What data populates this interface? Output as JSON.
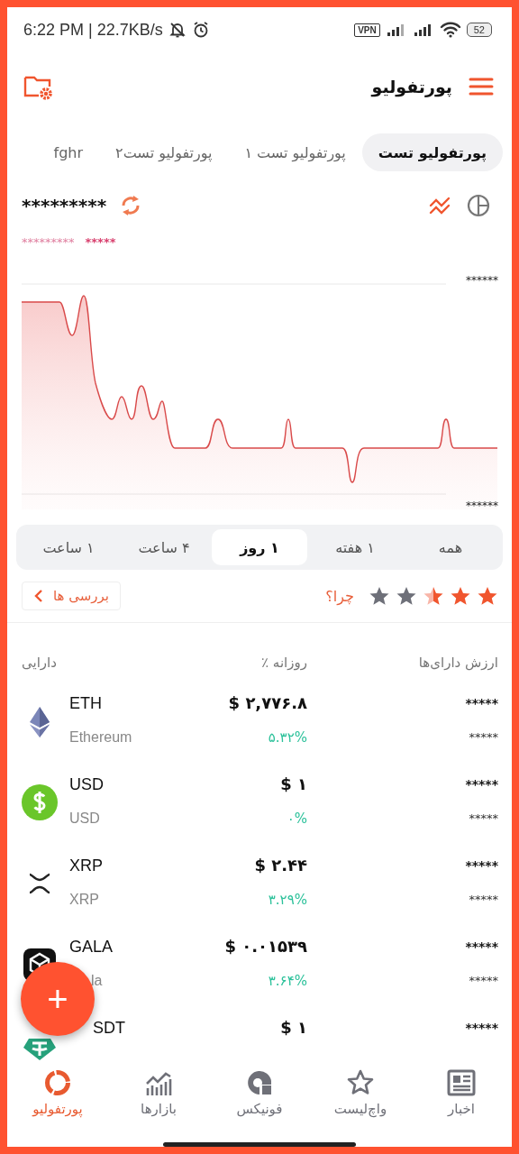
{
  "status_bar": {
    "time": "6:22 PM | 22.7KB/s",
    "vpn": "VPN",
    "battery": "52"
  },
  "header": {
    "title": "پورتفولیو"
  },
  "portfolio_tabs": [
    {
      "label": "پورتفولیو تست",
      "selected": true
    },
    {
      "label": "پورتفولیو تست ۱",
      "selected": false
    },
    {
      "label": "پورتفولیو تست۲",
      "selected": false
    },
    {
      "label": "fghr",
      "selected": false
    }
  ],
  "summary": {
    "total": "*********",
    "change_amount": "*********",
    "change_percent": "*****"
  },
  "chart": {
    "top_label": "******",
    "bottom_label": "******"
  },
  "ranges": [
    {
      "label": "همه",
      "selected": false
    },
    {
      "label": "۱ هفته",
      "selected": false
    },
    {
      "label": "۱ روز",
      "selected": true
    },
    {
      "label": "۴ ساعت",
      "selected": false
    },
    {
      "label": "۱ ساعت",
      "selected": false
    }
  ],
  "rating": {
    "stars": 2.5,
    "why_link": "چرا؟",
    "reviews_button": "بررسی ها"
  },
  "table": {
    "columns": [
      "ارزش دارای‌ها",
      "روزانه ٪",
      "دارایی"
    ],
    "rows": [
      {
        "kind": "eth",
        "symbol": "ETH",
        "name": "Ethereum",
        "price": "$ ۲,۷۷۶.۸",
        "change": "۵.۳۲%",
        "value": "*****",
        "amount": "*****"
      },
      {
        "kind": "usd",
        "symbol": "USD",
        "name": "USD",
        "price": "$ ۱",
        "change": "۰%",
        "value": "*****",
        "amount": "*****"
      },
      {
        "kind": "xrp",
        "symbol": "XRP",
        "name": "XRP",
        "price": "$ ۲.۴۴",
        "change": "۳.۲۹%",
        "value": "*****",
        "amount": "*****"
      },
      {
        "kind": "gala",
        "symbol": "GALA",
        "name": "la",
        "price": "$ ۰.۰۱۵۳۹",
        "change": "۳.۶۴%",
        "value": "*****",
        "amount": "*****",
        "partly_covered": true
      },
      {
        "kind": "usdt",
        "symbol": "SDT",
        "price": "$ ۱",
        "value": "*****",
        "partly_covered": true
      }
    ]
  },
  "fab": {
    "label": "+"
  },
  "nav": [
    {
      "kind": "news",
      "label": "اخبار",
      "selected": false
    },
    {
      "kind": "watchlist",
      "label": "واچ‌لیست",
      "selected": false
    },
    {
      "kind": "phonix",
      "label": "فونیکس",
      "selected": false
    },
    {
      "kind": "markets",
      "label": "بازارها",
      "selected": false
    },
    {
      "kind": "portfolio",
      "label": "پورتفولیو",
      "selected": true
    }
  ]
}
